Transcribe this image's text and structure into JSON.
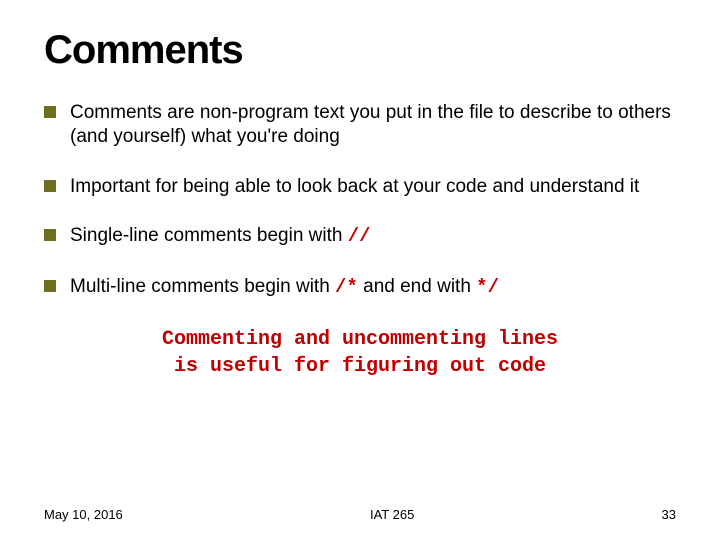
{
  "title": "Comments",
  "bullets": {
    "b1_pre": "Comments are non-program text you put in the file to describe to others (and yourself) what you're doing",
    "b2": "Important for being able to look back at your code and understand it",
    "b3_pre": "Single-line comments begin with ",
    "b3_code": "//",
    "b4_pre": "Multi-line comments begin with ",
    "b4_code1": "/*",
    "b4_mid": " and end with ",
    "b4_code2": "*/"
  },
  "tagline_l1": "Commenting and uncommenting lines",
  "tagline_l2": "is useful for figuring out code",
  "footer": {
    "date": "May 10, 2016",
    "course": "IAT 265",
    "page": "33"
  }
}
